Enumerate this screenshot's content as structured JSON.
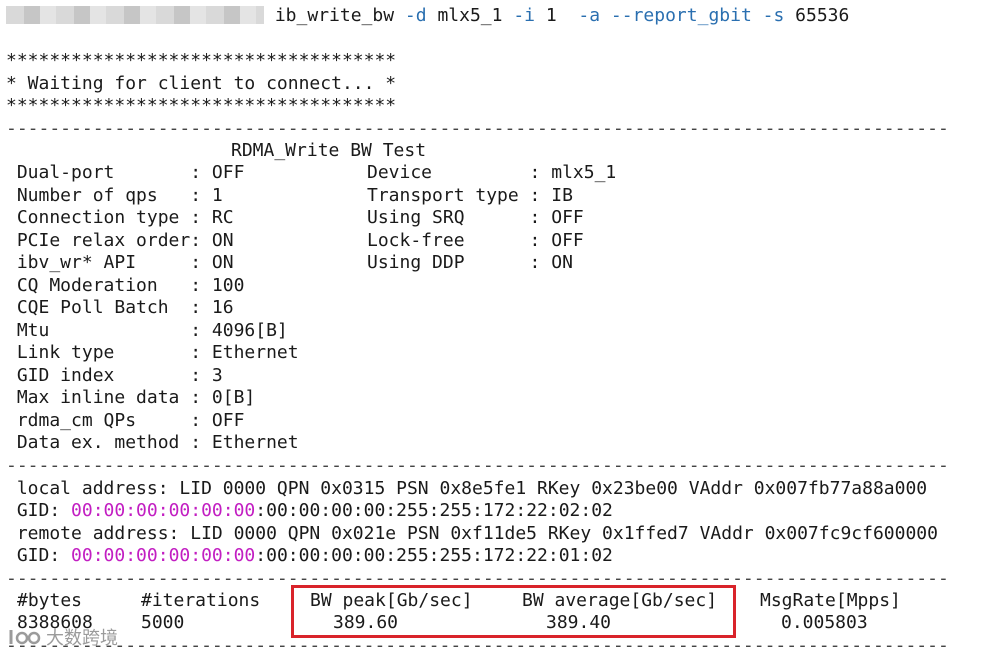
{
  "command": {
    "name": "ib_write_bw",
    "flag_d": "-d",
    "device": "mlx5_1",
    "flag_i": "-i",
    "port": "1",
    "flag_a": "-a",
    "flag_report": "--report_gbit",
    "flag_s": "-s",
    "size": "65536"
  },
  "banner": {
    "stars": "************************************",
    "message": "* Waiting for client to connect... *"
  },
  "separator": "---------------------------------------------------------------------------------------",
  "test_title": "RDMA_Write BW Test",
  "left_params": [
    " Dual-port       : OFF",
    " Number of qps   : 1",
    " Connection type : RC",
    " PCIe relax order: ON",
    " ibv_wr* API     : ON",
    " CQ Moderation   : 100",
    " CQE Poll Batch  : 16",
    " Mtu             : 4096[B]",
    " Link type       : Ethernet",
    " GID index       : 3",
    " Max inline data : 0[B]",
    " rdma_cm QPs     : OFF",
    " Data ex. method : Ethernet"
  ],
  "right_params": [
    "Device         : mlx5_1",
    "Transport type : IB",
    "Using SRQ      : OFF",
    "Lock-free      : OFF",
    "Using DDP      : ON"
  ],
  "addresses": {
    "local": " local address: LID 0000 QPN 0x0315 PSN 0x8e5fe1 RKey 0x23be00 VAddr 0x007fb77a88a000",
    "local_gid_label": " GID: ",
    "local_gid_magenta": "00:00:00:00:00:00",
    "local_gid_rest": ":00:00:00:00:255:255:172:22:02:02",
    "remote": " remote address: LID 0000 QPN 0x021e PSN 0xf11de5 RKey 0x1ffed7 VAddr 0x007fc9cf600000",
    "remote_gid_label": " GID: ",
    "remote_gid_magenta": "00:00:00:00:00:00",
    "remote_gid_rest": ":00:00:00:00:255:255:172:22:01:02"
  },
  "results": {
    "headers": [
      "#bytes",
      "#iterations",
      "BW peak[Gb/sec]",
      "BW average[Gb/sec]",
      "MsgRate[Mpps]"
    ],
    "values": [
      "8388608",
      "5000",
      "389.60",
      "389.40",
      "0.005803"
    ]
  },
  "watermark": {
    "text": "大数跨境"
  },
  "colors": {
    "flag": "#2a6fb0",
    "gid_highlight": "#c21ec2",
    "highlight_box": "#d9232a"
  }
}
